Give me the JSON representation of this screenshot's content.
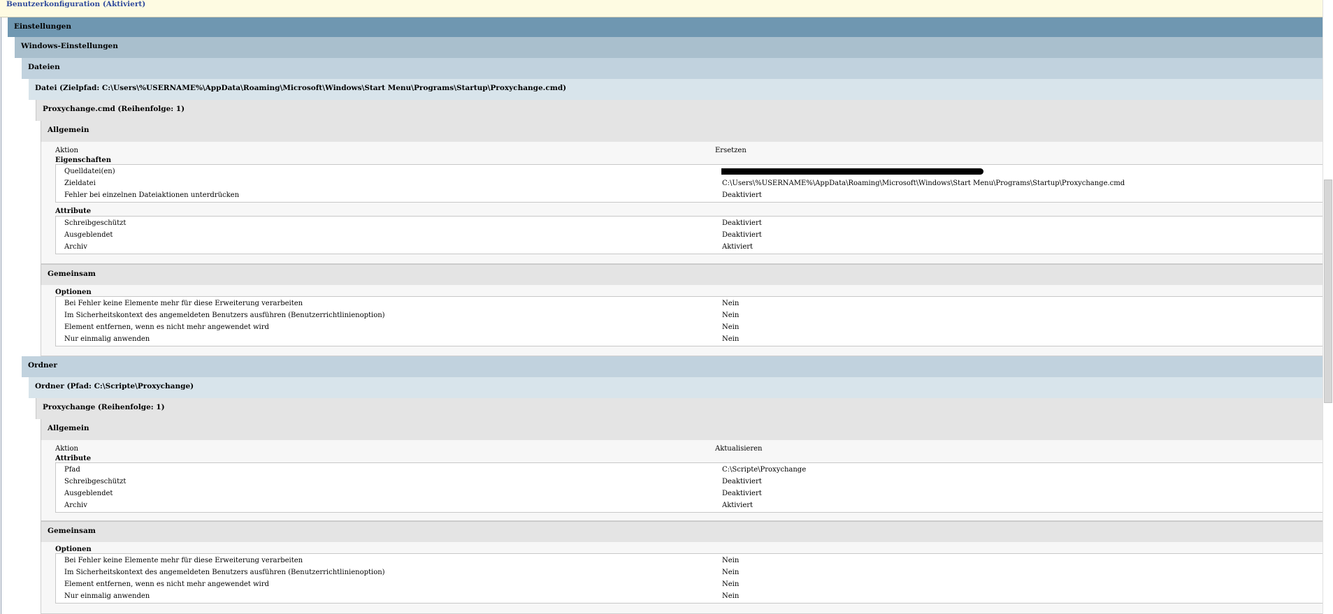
{
  "sections": {
    "root": "Benutzerkonfiguration (Aktiviert)",
    "einstellungen": "Einstellungen",
    "windows": "Windows-Einstellungen",
    "dateien": "Dateien",
    "datei": "Datei (Zielpfad: C:\\Users\\%USERNAME%\\AppData\\Roaming\\Microsoft\\Windows\\Start Menu\\Programs\\Startup\\Proxychange.cmd)",
    "proxycmd": "Proxychange.cmd (Reihenfolge: 1)",
    "ordner": "Ordner",
    "ordner_item": "Ordner (Pfad: C:\\Scripte\\Proxychange)",
    "proxychange": "Proxychange (Reihenfolge: 1)"
  },
  "file_block": {
    "allgemein": "Allgemein",
    "aktion_label": "Aktion",
    "aktion_value": "Ersetzen",
    "eigenschaften": "Eigenschaften",
    "props": [
      {
        "k": "Quelldatei(en)",
        "v": ""
      },
      {
        "k": "Zieldatei",
        "v": "C:\\Users\\%USERNAME%\\AppData\\Roaming\\Microsoft\\Windows\\Start Menu\\Programs\\Startup\\Proxychange.cmd"
      },
      {
        "k": "Fehler bei einzelnen Dateiaktionen unterdrücken",
        "v": "Deaktiviert"
      }
    ],
    "attribute": "Attribute",
    "attrs": [
      {
        "k": "Schreibgeschützt",
        "v": "Deaktiviert"
      },
      {
        "k": "Ausgeblendet",
        "v": "Deaktiviert"
      },
      {
        "k": "Archiv",
        "v": "Aktiviert"
      }
    ],
    "gemeinsam": "Gemeinsam",
    "optionen": "Optionen",
    "opts": [
      {
        "k": "Bei Fehler keine Elemente mehr für diese Erweiterung verarbeiten",
        "v": "Nein"
      },
      {
        "k": "Im Sicherheitskontext des angemeldeten Benutzers ausführen (Benutzerrichtlinienoption)",
        "v": "Nein"
      },
      {
        "k": "Element entfernen, wenn es nicht mehr angewendet wird",
        "v": "Nein"
      },
      {
        "k": "Nur einmalig anwenden",
        "v": "Nein"
      }
    ]
  },
  "folder_block": {
    "allgemein": "Allgemein",
    "aktion_label": "Aktion",
    "aktion_value": "Aktualisieren",
    "attribute": "Attribute",
    "attrs": [
      {
        "k": "Pfad",
        "v": "C:\\Scripte\\Proxychange"
      },
      {
        "k": "Schreibgeschützt",
        "v": "Deaktiviert"
      },
      {
        "k": "Ausgeblendet",
        "v": "Deaktiviert"
      },
      {
        "k": "Archiv",
        "v": "Aktiviert"
      }
    ],
    "gemeinsam": "Gemeinsam",
    "optionen": "Optionen",
    "opts": [
      {
        "k": "Bei Fehler keine Elemente mehr für diese Erweiterung verarbeiten",
        "v": "Nein"
      },
      {
        "k": "Im Sicherheitskontext des angemeldeten Benutzers ausführen (Benutzerrichtlinienoption)",
        "v": "Nein"
      },
      {
        "k": "Element entfernen, wenn es nicht mehr angewendet wird",
        "v": "Nein"
      },
      {
        "k": "Nur einmalig anwenden",
        "v": "Nein"
      }
    ]
  }
}
